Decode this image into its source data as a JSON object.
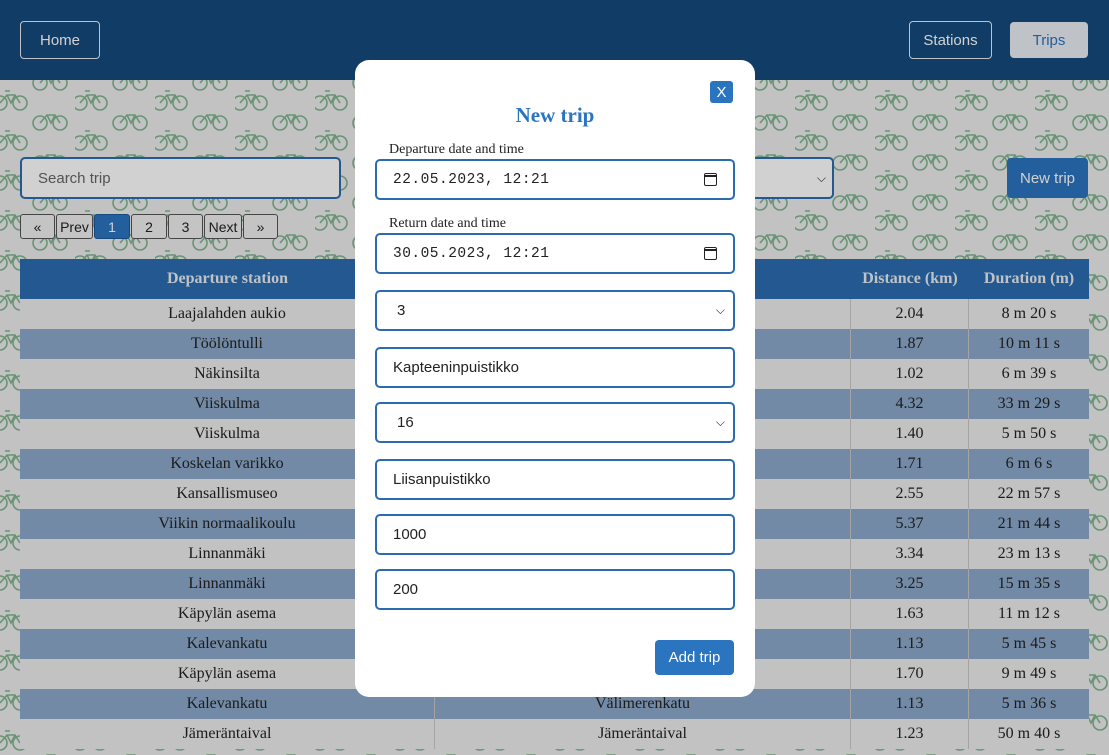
{
  "header": {
    "home_label": "Home",
    "stations_label": "Stations",
    "trips_label": "Trips"
  },
  "toolbar": {
    "search_placeholder": "Search trip",
    "new_trip_label": "New trip"
  },
  "pagination": {
    "first": "«",
    "prev": "Prev",
    "pages": [
      "1",
      "2",
      "3"
    ],
    "active_page": "1",
    "next": "Next",
    "last": "»"
  },
  "table": {
    "headers": [
      "Departure station",
      "",
      "Distance (km)",
      "Duration (m)"
    ],
    "rows": [
      [
        "Laajalahden aukio",
        "",
        "2.04",
        "8 m 20 s"
      ],
      [
        "Töölöntulli",
        "",
        "1.87",
        "10 m 11 s"
      ],
      [
        "Näkinsilta",
        "",
        "1.02",
        "6 m 39 s"
      ],
      [
        "Viiskulma",
        "",
        "4.32",
        "33 m 29 s"
      ],
      [
        "Viiskulma",
        "",
        "1.40",
        "5 m 50 s"
      ],
      [
        "Koskelan varikko",
        "",
        "1.71",
        "6 m 6 s"
      ],
      [
        "Kansallismuseo",
        "",
        "2.55",
        "22 m 57 s"
      ],
      [
        "Viikin normaalikoulu",
        "",
        "5.37",
        "21 m 44 s"
      ],
      [
        "Linnanmäki",
        "",
        "3.34",
        "23 m 13 s"
      ],
      [
        "Linnanmäki",
        "",
        "3.25",
        "15 m 35 s"
      ],
      [
        "Käpylän asema",
        "",
        "1.63",
        "11 m 12 s"
      ],
      [
        "Kalevankatu",
        "",
        "1.13",
        "5 m 45 s"
      ],
      [
        "Käpylän asema",
        "",
        "1.70",
        "9 m 49 s"
      ],
      [
        "Kalevankatu",
        "Välimerenkatu",
        "1.13",
        "5 m 36 s"
      ],
      [
        "Jämeräntaival",
        "Jämeräntaival",
        "1.23",
        "50 m 40 s"
      ]
    ]
  },
  "modal": {
    "close_label": "X",
    "title": "New trip",
    "departure_label": "Departure date and time",
    "departure_value": "22.05.2023, 12:21",
    "return_label": "Return date and time",
    "return_value": "30.05.2023, 12:21",
    "departure_station_id": "3",
    "departure_station_name": "Kapteeninpuistikko",
    "return_station_id": "16",
    "return_station_name": "Liisanpuistikko",
    "distance_value": "1000",
    "duration_value": "200",
    "add_label": "Add trip"
  },
  "colors": {
    "header": "#154a7c",
    "accent": "#2b74c0",
    "row_alt": "#8ca9cb",
    "bike_pattern": "#7fb58f"
  },
  "icons": {
    "calendar": "calendar-icon",
    "chevron": "chevron-down-icon",
    "bike": "bike-pattern"
  }
}
